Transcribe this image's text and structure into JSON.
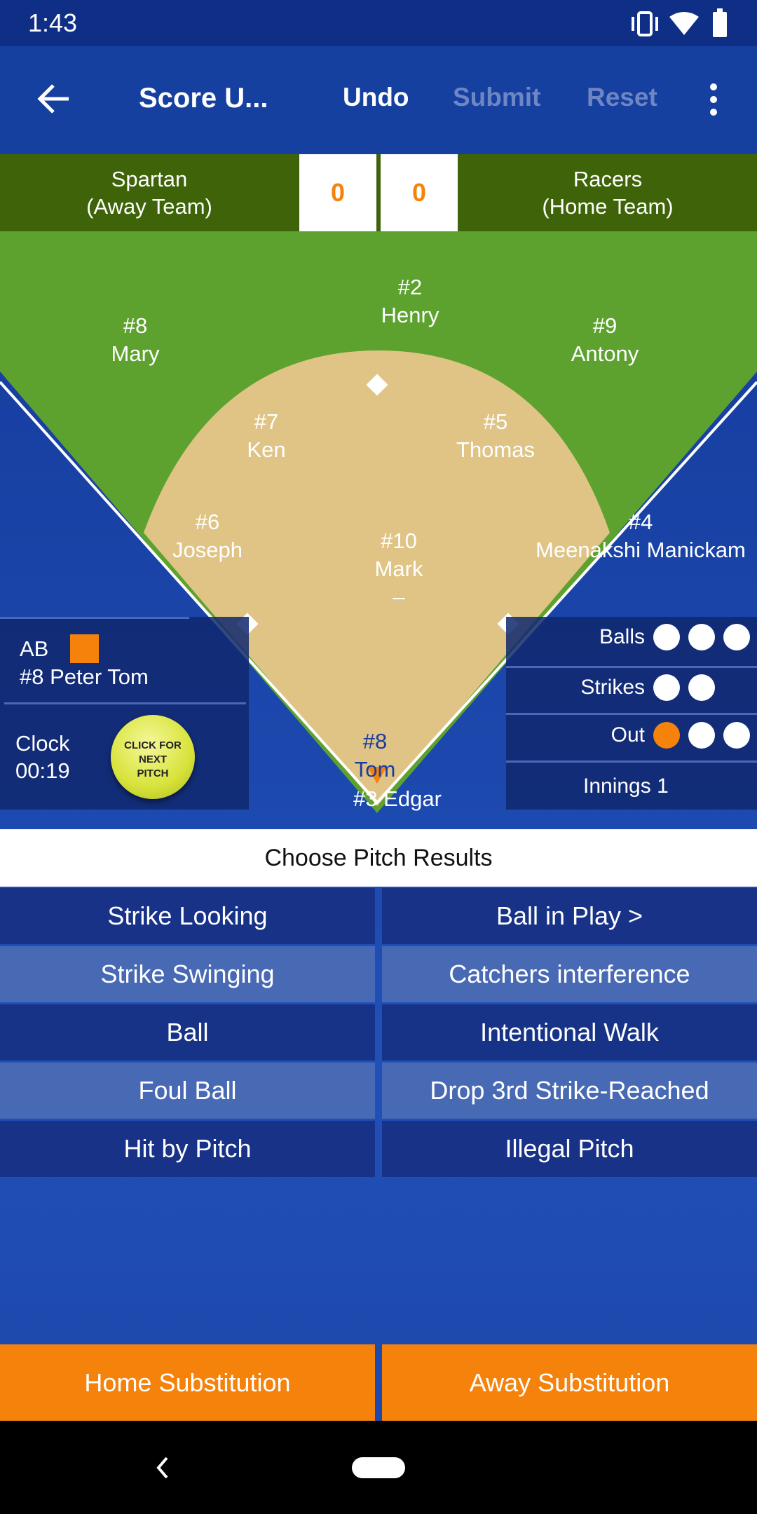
{
  "status_bar": {
    "time": "1:43",
    "icons": [
      "vibrate-icon",
      "wifi-icon",
      "battery-icon"
    ]
  },
  "toolbar": {
    "title": "Score U...",
    "undo": "Undo",
    "submit": "Submit",
    "reset": "Reset"
  },
  "scoreboard": {
    "away_name": "Spartan",
    "away_label": "(Away Team)",
    "away_score": "0",
    "home_score": "0",
    "home_name": "Racers",
    "home_label": "(Home Team)"
  },
  "field": {
    "players": [
      {
        "num": "#2",
        "name": "Henry"
      },
      {
        "num": "#8",
        "name": "Mary"
      },
      {
        "num": "#9",
        "name": "Antony"
      },
      {
        "num": "#7",
        "name": "Ken"
      },
      {
        "num": "#5",
        "name": "Thomas"
      },
      {
        "num": "#6",
        "name": "Joseph"
      },
      {
        "num": "#10",
        "name": "Mark"
      },
      {
        "num": "#4",
        "name": "Meenakshi Manickam"
      }
    ],
    "pitcher_extra": "–",
    "catcher": {
      "num": "#8",
      "name": "Tom"
    },
    "batter": "#3 Edgar"
  },
  "at_bat": {
    "label": "AB",
    "player": "#8 Peter Tom",
    "clock_label": "Clock",
    "clock": "00:19",
    "pitch_button": "CLICK FOR NEXT PITCH"
  },
  "count": {
    "balls_label": "Balls",
    "balls": 0,
    "balls_max": 3,
    "strikes_label": "Strikes",
    "strikes": 0,
    "strikes_max": 2,
    "out_label": "Out",
    "outs": 1,
    "outs_max": 3,
    "innings": "Innings 1"
  },
  "colors": {
    "accent": "#f5820a",
    "field_green": "#5da22e",
    "dirt": "#dfc485",
    "score_bar": "#3e6308"
  },
  "pitch_results": {
    "title": "Choose Pitch Results",
    "left": [
      "Strike Looking",
      "Strike Swinging",
      "Ball",
      "Foul Ball",
      "Hit by Pitch"
    ],
    "right": [
      "Ball in Play >",
      "Catchers interference",
      "Intentional Walk",
      "Drop 3rd Strike-Reached",
      "Illegal Pitch"
    ]
  },
  "substitution": {
    "home": "Home Substitution",
    "away": "Away Substitution"
  }
}
